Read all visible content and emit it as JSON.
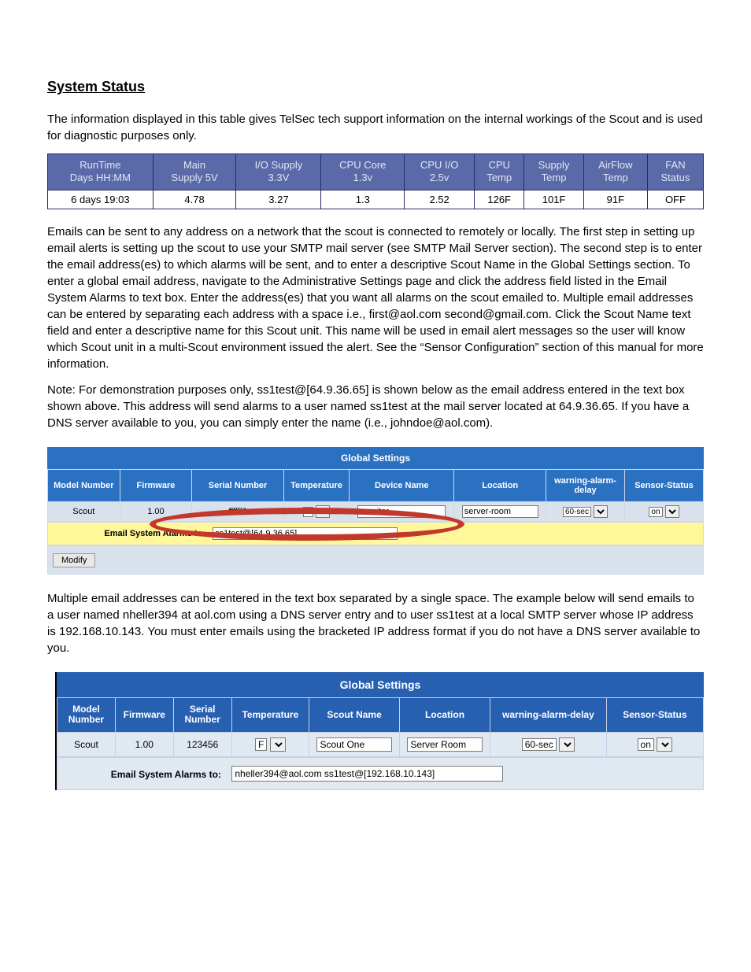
{
  "section1": {
    "heading": "System Status",
    "p1": "The information displayed in this table gives TelSec tech support information on the internal workings of the Scout and is used for diagnostic purposes only."
  },
  "hw_table": {
    "headers": [
      "RunTime\nDays HH:MM",
      "Main\nSupply 5V",
      "I/O Supply\n3.3V",
      "CPU Core\n1.3v",
      "CPU I/O\n2.5v",
      "CPU\nTemp",
      "Supply\nTemp",
      "AirFlow\nTemp",
      "FAN\nStatus"
    ],
    "row": [
      "6 days 19:03",
      "4.78",
      "3.27",
      "1.3",
      "2.52",
      "126F",
      "101F",
      "91F",
      "OFF"
    ]
  },
  "email_paragraphs": {
    "p1": "Emails can be sent to any address on a network that the scout is connected to remotely or locally. The first step in setting up email alerts is setting up the scout to use your SMTP mail server (see SMTP Mail Server section). The second step is to enter the email address(es) to which alarms will be sent, and to enter a descriptive Scout Name in the Global Settings section. To enter a global email address, navigate to the Administrative Settings page and click the address field listed in the Email System Alarms to text box. Enter the address(es) that you want all alarms on the scout emailed to. Multiple email addresses can be entered by separating each address with a space i.e., first@aol.com second@gmail.com. Click the Scout Name text field and enter a descriptive name for this Scout unit. This name will be used in email alert messages so the user will know which Scout unit in a multi-Scout environment issued the alert. See the “Sensor Configuration” section of this manual for more information.",
    "p1b": "Note: For demonstration purposes only, ss1test@[64.9.36.65] is shown below as the email address entered in the text box shown above. This address will send alarms to a user named ss1test at the mail server located at 64.9.36.65. If you have a DNS server available to you, you can simply enter the name (i.e., johndoe@aol.com).",
    "p2": "Multiple email addresses can be entered in the text box separated by a single space. The example below will send emails to a user named nheller394 at aol.com using a DNS server entry and to user ss1test at a local SMTP server whose IP address is 192.168.10.143. You must enter emails using the bracketed IP address format if you do not have a DNS server available to you."
  },
  "gs1": {
    "title": "Global Settings",
    "headers": [
      "Model Number",
      "Firmware",
      "Serial Number",
      "Temperature",
      "Device Name",
      "Location",
      "warning-alarm-delay",
      "Sensor-Status"
    ],
    "row": {
      "model": "Scout",
      "firmware": "1.00",
      "serial": "ffffff6",
      "temp_value": "F",
      "device_name": "monitor",
      "location": "server-room",
      "delay": "60-sec",
      "sensor": "on"
    },
    "email_label": "Email System Alarms to:",
    "email_value": "ss1test@[64.9.36.65]",
    "modify": "Modify"
  },
  "gs2": {
    "title": "Global Settings",
    "headers": [
      "Model\nNumber",
      "Firmware",
      "Serial\nNumber",
      "Temperature",
      "Scout Name",
      "Location",
      "warning-alarm-delay",
      "Sensor-Status"
    ],
    "row": {
      "model": "Scout",
      "firmware": "1.00",
      "serial": "123456",
      "temp_value": "F",
      "scout_name": "Scout One",
      "location": "Server Room",
      "delay": "60-sec",
      "sensor": "on"
    },
    "email_label": "Email System Alarms to:",
    "email_value": "nheller394@aol.com ss1test@[192.168.10.143]"
  }
}
